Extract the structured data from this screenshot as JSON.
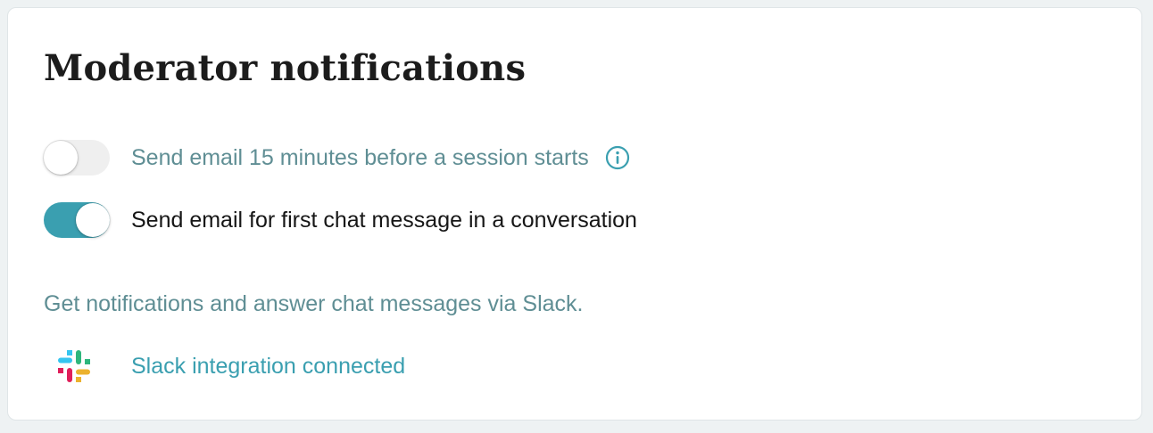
{
  "card": {
    "title": "Moderator notifications"
  },
  "settings": [
    {
      "label": "Send email 15 minutes before a session starts",
      "enabled": false,
      "icon": "info-icon"
    },
    {
      "label": "Send email for first chat message in a conversation",
      "enabled": true
    }
  ],
  "slack": {
    "description": "Get notifications and answer chat messages via Slack.",
    "link_label": "Slack integration connected",
    "icon": "slack-logo"
  },
  "colors": {
    "accent": "#3a9fb0",
    "muted_text": "#5f8e94",
    "toggle_off": "#efefef",
    "slack_blue": "#36C5F0",
    "slack_green": "#2EB67D",
    "slack_red": "#E01E5A",
    "slack_yellow": "#ECB22E"
  }
}
